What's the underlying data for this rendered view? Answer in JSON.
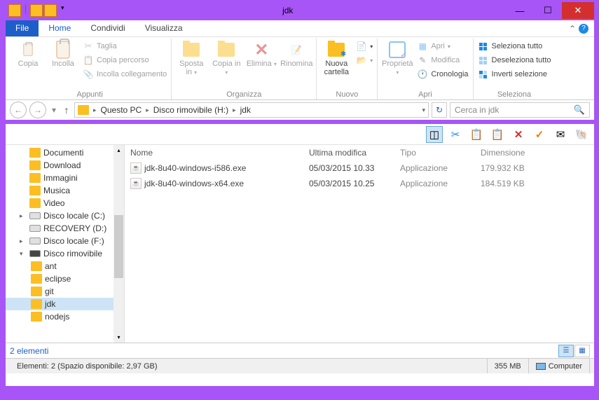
{
  "window": {
    "title": "jdk"
  },
  "tabs": {
    "file": "File",
    "home": "Home",
    "share": "Condividi",
    "view": "Visualizza"
  },
  "ribbon": {
    "clipboard": {
      "copy": "Copia",
      "paste": "Incolla",
      "cut": "Taglia",
      "copy_path": "Copia percorso",
      "paste_link": "Incolla collegamento",
      "group": "Appunti"
    },
    "organize": {
      "move_to": "Sposta in",
      "copy_to": "Copia in",
      "delete": "Elimina",
      "rename": "Rinomina",
      "group": "Organizza"
    },
    "new": {
      "new_folder": "Nuova cartella",
      "group": "Nuovo"
    },
    "open": {
      "properties": "Proprietà",
      "open": "Apri",
      "edit": "Modifica",
      "history": "Cronologia",
      "group": "Apri"
    },
    "select": {
      "select_all": "Seleziona tutto",
      "select_none": "Deseleziona tutto",
      "invert": "Inverti selezione",
      "group": "Seleziona"
    }
  },
  "breadcrumb": {
    "root": "Questo PC",
    "drive": "Disco rimovibile (H:)",
    "folder": "jdk"
  },
  "search": {
    "placeholder": "Cerca in jdk"
  },
  "columns": {
    "name": "Nome",
    "modified": "Ultima modifica",
    "type": "Tipo",
    "size": "Dimensione"
  },
  "files": [
    {
      "name": "jdk-8u40-windows-i586.exe",
      "modified": "05/03/2015 10.33",
      "type": "Applicazione",
      "size": "179.932 KB"
    },
    {
      "name": "jdk-8u40-windows-x64.exe",
      "modified": "05/03/2015 10.25",
      "type": "Applicazione",
      "size": "184.519 KB"
    }
  ],
  "tree": {
    "documents": "Documenti",
    "download": "Download",
    "images": "Immagini",
    "music": "Musica",
    "video": "Video",
    "disk_c": "Disco locale (C:)",
    "recovery": "RECOVERY (D:)",
    "disk_f": "Disco locale (F:)",
    "removable": "Disco rimovibile",
    "ant": "ant",
    "eclipse": "eclipse",
    "git": "git",
    "jdk": "jdk",
    "nodejs": "nodejs"
  },
  "status": {
    "count": "2 elementi",
    "detail": "Elementi: 2 (Spazio disponibile: 2,97 GB)",
    "selected_size": "355 MB",
    "computer": "Computer"
  }
}
